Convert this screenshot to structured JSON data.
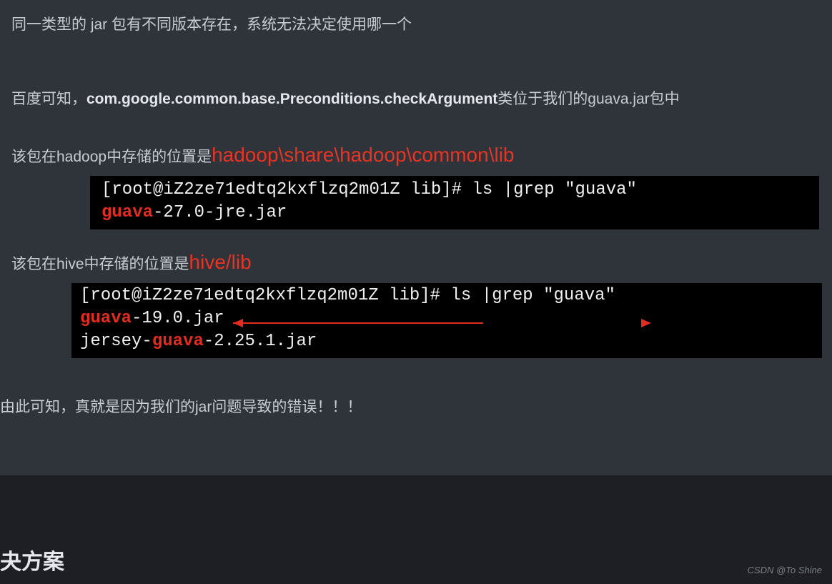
{
  "para1": "同一类型的 jar 包有不同版本存在，系统无法决定使用哪一个",
  "para2_prefix": "百度可知，",
  "para2_strong": "com.google.common.base.Preconditions.checkArgument",
  "para2_suffix": "类位于我们的guava.jar包中",
  "hadoop_label": "该包在hadoop中存储的位置是",
  "hadoop_path": "hadoop\\share\\hadoop\\common\\lib",
  "term1": {
    "line1_prompt": "[root@iZ2ze71edtq2kxflzq2m01Z lib]# ls  |grep \"guava\"",
    "line2_red": "guava",
    "line2_rest": "-27.0-jre.jar"
  },
  "hive_label": "该包在hive中存储的位置是",
  "hive_path": "hive/lib",
  "term2": {
    "line1_prompt": "[root@iZ2ze71edtq2kxflzq2m01Z lib]# ls  |grep \"guava\"",
    "line2_red": "guava",
    "line2_rest": "-19.0.jar",
    "line3_pre": "jersey-",
    "line3_red": "guava",
    "line3_rest": "-2.25.1.jar"
  },
  "conclusion": "由此可知，真就是因为我们的jar问题导致的错误！！！",
  "solution_heading": "夬方案",
  "watermark": "CSDN @To Shine"
}
